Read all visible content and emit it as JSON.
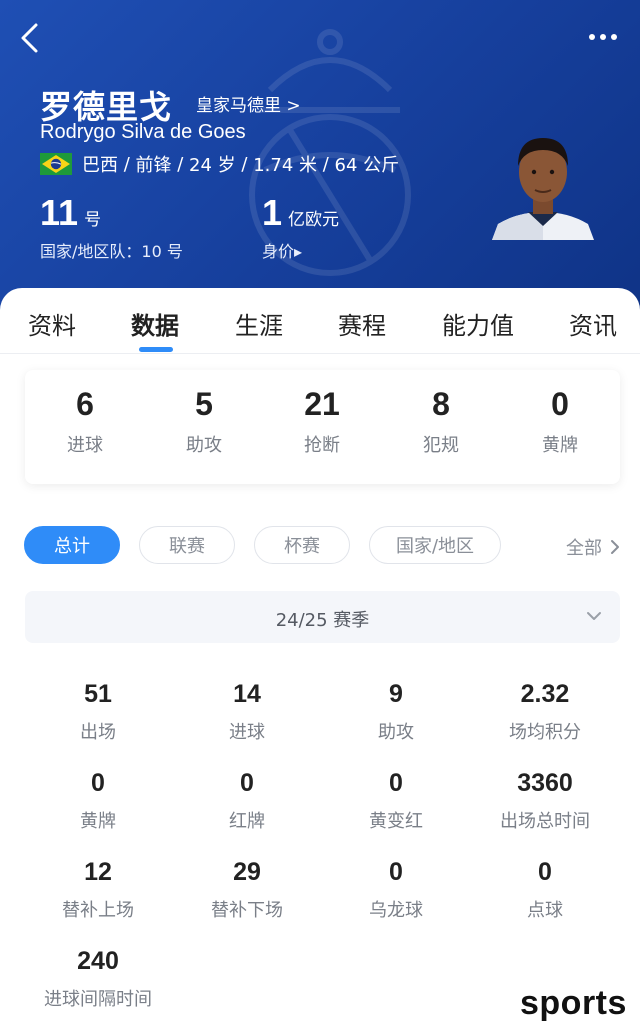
{
  "header": {
    "name_cn": "罗德里戈",
    "club_link": "皇家马德里 >",
    "name_en": "Rodrygo Silva de Goes",
    "country": "巴西",
    "position": "前锋",
    "age": "24 岁",
    "height": "1.74 米",
    "weight": "64 公斤",
    "shirt_number": "11",
    "shirt_unit": "号",
    "national_team": "国家/地区队：10 号",
    "market_value": "1",
    "market_value_unit": "亿欧元",
    "market_value_label": "身价▸",
    "colors": {
      "bg": "#1f4fb4",
      "accent": "#2f8cf8"
    }
  },
  "tabs": [
    {
      "label": "资料"
    },
    {
      "label": "数据",
      "active": true
    },
    {
      "label": "生涯"
    },
    {
      "label": "赛程"
    },
    {
      "label": "能力值"
    },
    {
      "label": "资讯"
    }
  ],
  "summary": [
    {
      "value": "6",
      "label": "进球"
    },
    {
      "value": "5",
      "label": "助攻"
    },
    {
      "value": "21",
      "label": "抢断"
    },
    {
      "value": "8",
      "label": "犯规"
    },
    {
      "value": "0",
      "label": "黄牌"
    }
  ],
  "filters": {
    "pills": [
      {
        "label": "总计",
        "active": true
      },
      {
        "label": "联赛"
      },
      {
        "label": "杯赛"
      },
      {
        "label": "国家/地区"
      }
    ],
    "all_label": "全部"
  },
  "season": {
    "selected": "24/25 赛季"
  },
  "stats": [
    {
      "value": "51",
      "label": "出场"
    },
    {
      "value": "14",
      "label": "进球"
    },
    {
      "value": "9",
      "label": "助攻"
    },
    {
      "value": "2.32",
      "label": "场均积分"
    },
    {
      "value": "0",
      "label": "黄牌"
    },
    {
      "value": "0",
      "label": "红牌"
    },
    {
      "value": "0",
      "label": "黄变红"
    },
    {
      "value": "3360",
      "label": "出场总时间"
    },
    {
      "value": "12",
      "label": "替补上场"
    },
    {
      "value": "29",
      "label": "替补下场"
    },
    {
      "value": "0",
      "label": "乌龙球"
    },
    {
      "value": "0",
      "label": "点球"
    },
    {
      "value": "240",
      "label": "进球间隔时间"
    }
  ],
  "watermark": "sports"
}
